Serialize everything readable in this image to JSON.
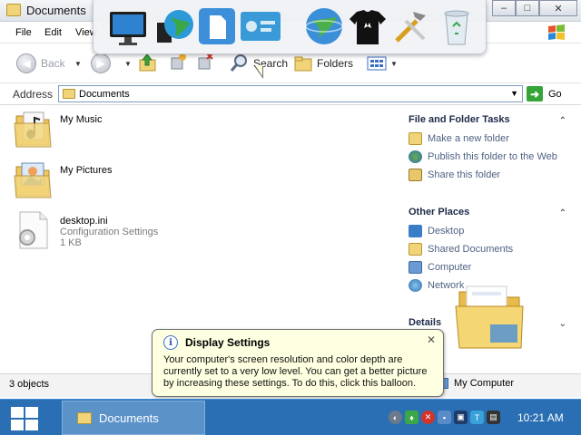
{
  "window": {
    "title": "Documents",
    "controls": {
      "minimize": "–",
      "maximize": "□",
      "close": "✕"
    }
  },
  "menu": {
    "items": [
      "File",
      "Edit",
      "View"
    ]
  },
  "toolbar": {
    "back_label": "Back",
    "search_label": "Search",
    "folders_label": "Folders"
  },
  "address": {
    "label": "Address",
    "value": "Documents",
    "go_label": "Go"
  },
  "files": [
    {
      "name": "My Music",
      "sub1": "",
      "sub2": ""
    },
    {
      "name": "My Pictures",
      "sub1": "",
      "sub2": ""
    },
    {
      "name": "desktop.ini",
      "sub1": "Configuration Settings",
      "sub2": "1 KB"
    }
  ],
  "tasks_pane": {
    "file_folder_tasks": {
      "title": "File and Folder Tasks",
      "items": [
        "Make a new folder",
        "Publish this folder to the Web",
        "Share this folder"
      ]
    },
    "other_places": {
      "title": "Other Places",
      "items": [
        "Desktop",
        "Shared Documents",
        "Computer",
        "Network"
      ]
    },
    "details": {
      "title": "Details"
    }
  },
  "status": {
    "count": "3 objects",
    "location": "My Computer"
  },
  "balloon": {
    "title": "Display Settings",
    "body": "Your computer's screen resolution and color depth are currently set to a very low level. You can get a better picture by increasing these settings. To do this, click this balloon."
  },
  "taskbar": {
    "active_window": "Documents",
    "clock": "10:21 AM"
  },
  "colors": {
    "taskbar": "#2a6fb3",
    "pane_link": "#4f6283",
    "balloon_bg": "#ffffe1"
  }
}
